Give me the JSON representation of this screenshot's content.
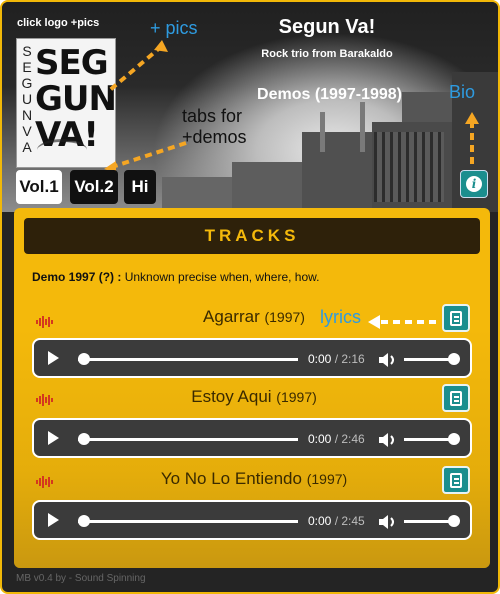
{
  "header": {
    "click_logo": "click logo +pics",
    "band_name": "Segun Va!",
    "band_sub": "Rock trio from Barakaldo",
    "demos_title": "Demos (1997-1998)",
    "logo_vertical": [
      "S",
      "E",
      "G",
      "U",
      "N",
      "V",
      "A"
    ],
    "logo_big": [
      "SEG",
      "GUN",
      "VA!"
    ]
  },
  "annotations": {
    "pics": "+ pics",
    "tabs": "tabs for",
    "tabs2": "+demos",
    "bio": "Bio",
    "lyrics": "lyrics"
  },
  "tabs": [
    {
      "label": "Vol.1",
      "active": true
    },
    {
      "label": "Vol.2",
      "active": false
    },
    {
      "label": "Hi",
      "active": false
    }
  ],
  "icons": {
    "info": "info-icon",
    "lyrics": "lyrics-doc-icon",
    "play": "play-icon",
    "volume": "volume-icon",
    "waveform": "waveform-icon"
  },
  "colors": {
    "accent_yellow": "#f4b90b",
    "teal_button": "#1b8e8e",
    "annotation_blue": "#2e9be0",
    "annotation_arrow": "#f5a623",
    "waveform_red": "#d4381e"
  },
  "tracks_heading": "TRACKS",
  "demo_desc": {
    "bold": "Demo 1997 (?) :",
    "text": " Unknown precise when, where, how."
  },
  "tracks": [
    {
      "name": "Agarrar",
      "year": "(1997)",
      "current": "0:00",
      "duration": "/ 2:16",
      "progress": 0
    },
    {
      "name": "Estoy Aqui",
      "year": "(1997)",
      "current": "0:00",
      "duration": "/ 2:46",
      "progress": 0
    },
    {
      "name": "Yo No Lo Entiendo",
      "year": "(1997)",
      "current": "0:00",
      "duration": "/ 2:45",
      "progress": 0
    }
  ],
  "footer": "MB v0.4 by - Sound Spinning"
}
